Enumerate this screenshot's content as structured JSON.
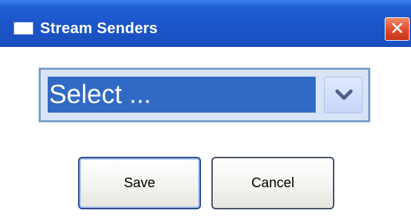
{
  "window": {
    "title": "Stream Senders",
    "title_icon": "window-icon",
    "close_icon": "close-icon",
    "close_glyph": "✕"
  },
  "select": {
    "value": "Select ...",
    "arrow_icon": "chevron-down-icon"
  },
  "buttons": {
    "save_label": "Save",
    "cancel_label": "Cancel"
  },
  "colors": {
    "titlebar": "#1f5fd3",
    "selection": "#316ac5",
    "close": "#e04b2a"
  }
}
